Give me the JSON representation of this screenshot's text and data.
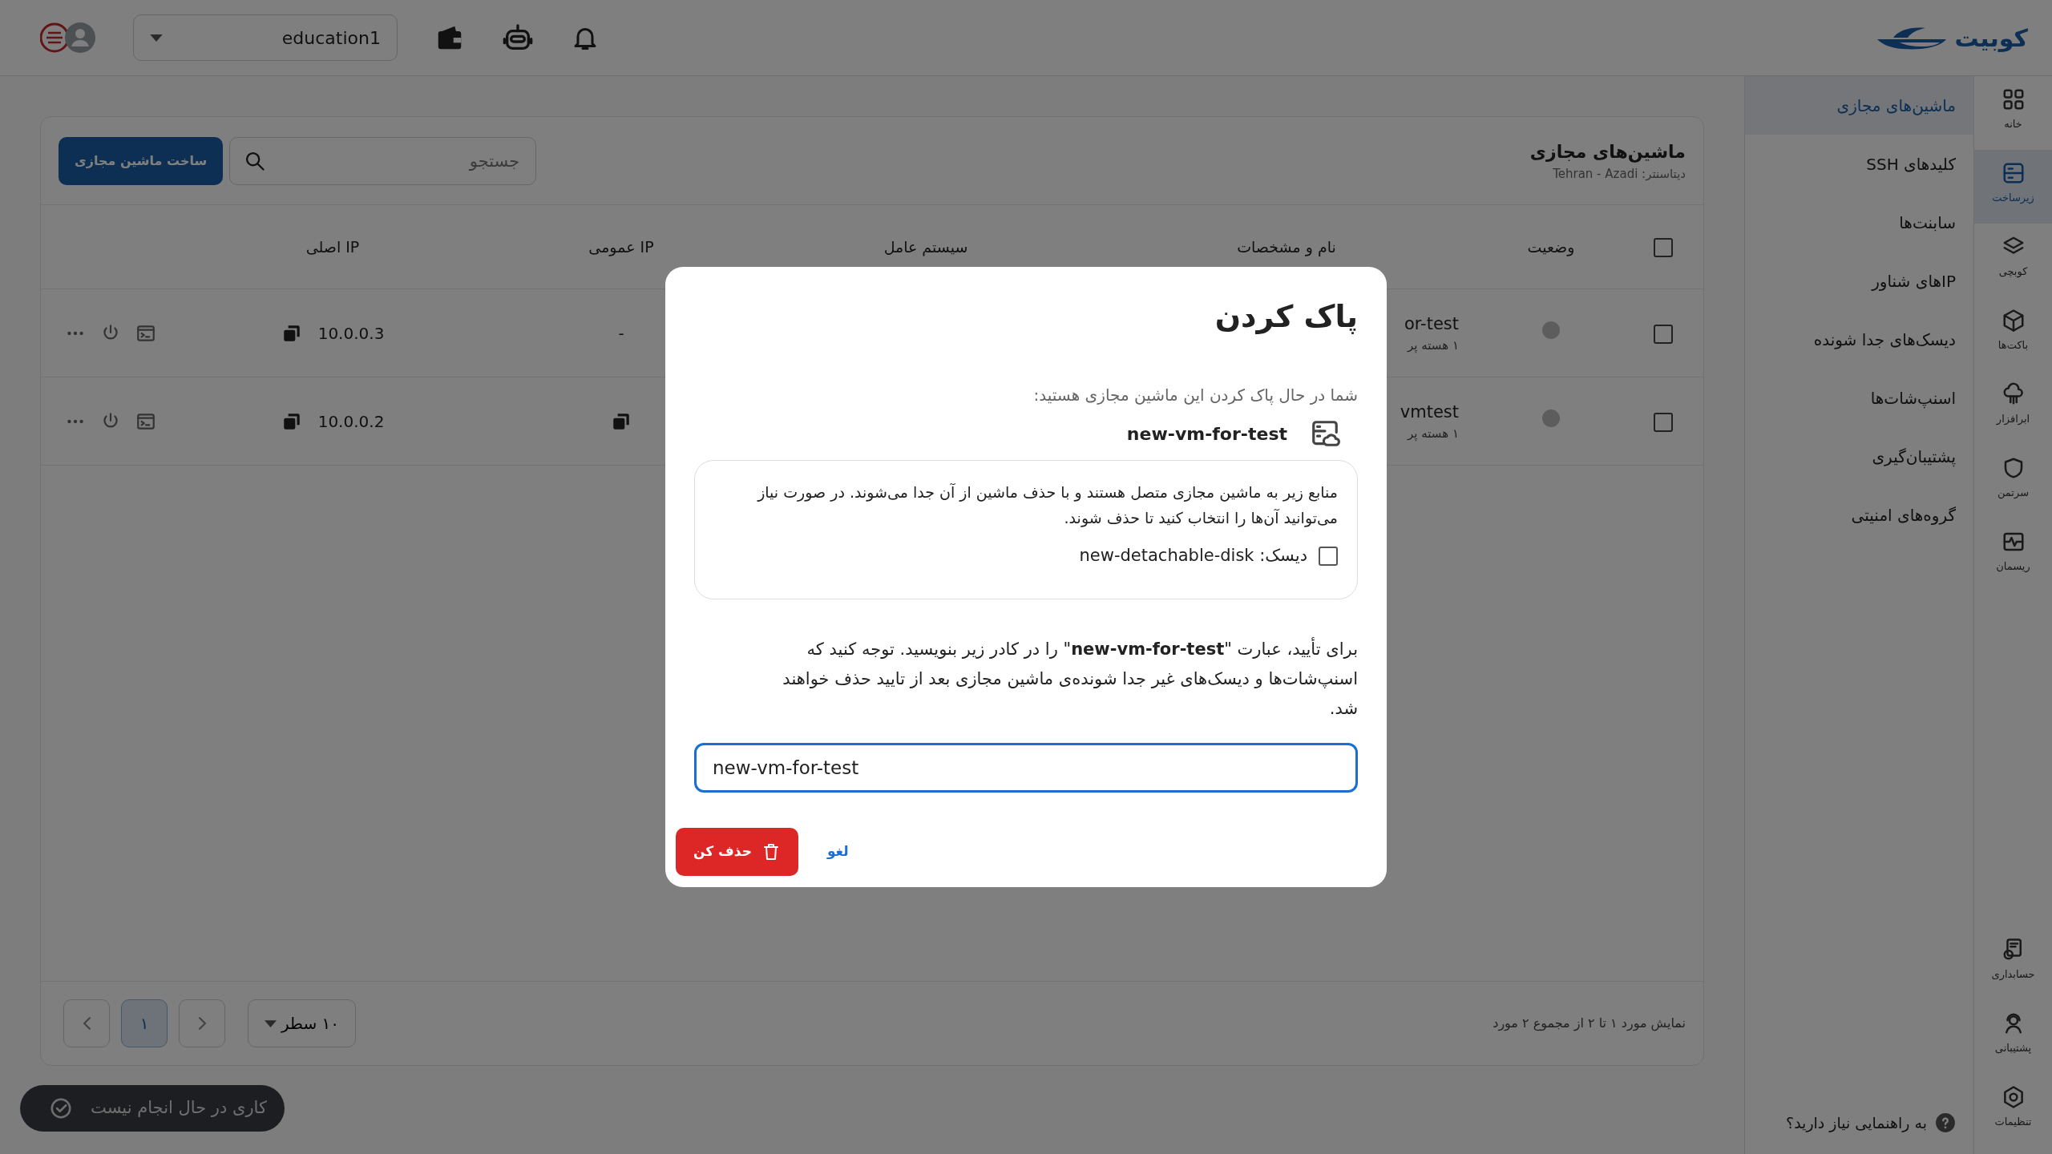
{
  "brand": {
    "logo_text": "کوبیت"
  },
  "top_bar": {
    "project": "education1"
  },
  "rail": [
    {
      "label": "خانه",
      "selected": false
    },
    {
      "label": "زیرساخت",
      "selected": true
    },
    {
      "label": "کوبچی",
      "selected": false
    },
    {
      "label": "باکت‌ها",
      "selected": false
    },
    {
      "label": "ابرافزار",
      "selected": false
    },
    {
      "label": "سرتمن",
      "selected": false
    },
    {
      "label": "ریسمان",
      "selected": false
    }
  ],
  "rail_bottom": [
    {
      "label": "حسابداری",
      "selected": false
    },
    {
      "label": "پشتیبانی",
      "selected": false
    },
    {
      "label": "تنظیمات",
      "selected": false
    }
  ],
  "submenu": [
    {
      "label": "ماشین‌های مجازی",
      "selected": true
    },
    {
      "label": "کلیدهای SSH",
      "selected": false
    },
    {
      "label": "سابنت‌ها",
      "selected": false
    },
    {
      "label": "IPهای شناور",
      "selected": false
    },
    {
      "label": "دیسک‌های جدا شونده",
      "selected": false
    },
    {
      "label": "اسنپ‌شات‌ها",
      "selected": false
    },
    {
      "label": "پشتیبان‌گیری",
      "selected": false
    },
    {
      "label": "گروه‌های امنیتی",
      "selected": false
    }
  ],
  "help": "به راهنمایی نیاز دارید؟",
  "page": {
    "title": "ماشین‌های مجازی",
    "subtitle": "دیتاسنتر: Tehran - Azadi",
    "search_placeholder": "جستجو",
    "create_button": "ساخت ماشین مجازی"
  },
  "table": {
    "select_all_checked": false,
    "columns": [
      "وضعیت",
      "نام و مشخصات",
      "سیستم عامل",
      "IP عمومی",
      "IP اصلی"
    ],
    "rows": [
      {
        "checked": false,
        "name": "or-test",
        "specs": "۱ هسته پر",
        "public_ip": "-",
        "public_ip_copyable": false,
        "private_ip": "10.0.0.3"
      },
      {
        "checked": false,
        "name": "vmtest",
        "specs": "۱ هسته پر",
        "public_ip_copyable": true,
        "private_ip": "10.0.0.2"
      }
    ]
  },
  "pagination": {
    "summary": "نمایش مورد ۱ تا ۲ از مجموع ۲ مورد",
    "page_size": "۱۰ سطر",
    "pages": [
      {
        "label": "۱",
        "selected": true
      }
    ]
  },
  "toast": "کاری در حال انجام نیست",
  "dialog": {
    "title": "پاک کردن",
    "intro": "شما در حال پاک کردن این ماشین مجازی هستید:",
    "vm_name": "new-vm-for-test",
    "resources_note": "منابع زیر به ماشین مجازی متصل هستند و با حذف ماشین از آن جدا می‌شوند. در صورت نیاز می‌توانید آن‌ها را انتخاب کنید تا حذف شوند.",
    "resources": [
      {
        "label": "دیسک: new-detachable-disk",
        "checked": false
      }
    ],
    "confirm_text": "برای تأیید، عبارت \"**new-vm-for-test**\" را در کادر زیر بنویسید. توجه کنید که اسنپ‌شات‌ها و دیسک‌های غیر جدا شونده‌ی ماشین مجازی بعد از تایید حذف خواهند شد.",
    "input_value": "new-vm-for-test",
    "delete_button": "حذف کن",
    "cancel_button": "لغو"
  }
}
